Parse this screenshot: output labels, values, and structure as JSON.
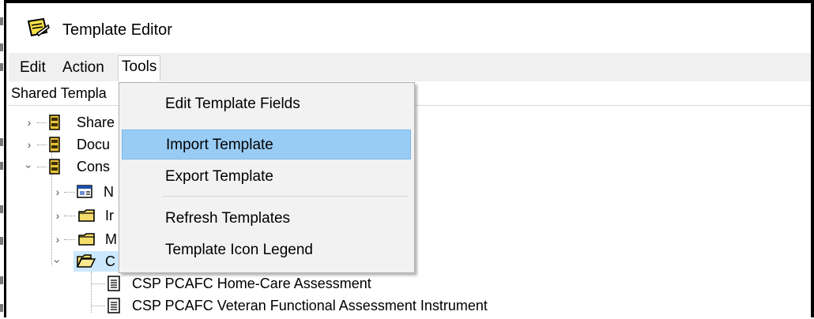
{
  "window": {
    "title": "Template Editor",
    "icon": "template-editor-icon"
  },
  "menubar": {
    "items": [
      {
        "label": "Edit",
        "mnemonic": "E"
      },
      {
        "label": "Action",
        "mnemonic": "A"
      },
      {
        "label": "Tools",
        "mnemonic": "T"
      }
    ]
  },
  "panel": {
    "header": "Shared Templa"
  },
  "tree": {
    "nodes": [
      {
        "label": "Share",
        "icon": "cabinet-icon",
        "expander": "collapsed"
      },
      {
        "label": "Docu",
        "icon": "cabinet-icon",
        "expander": "collapsed"
      },
      {
        "label": "Cons",
        "icon": "cabinet-icon",
        "expander": "expanded"
      },
      {
        "label": "N",
        "icon": "template-icon",
        "expander": "collapsed"
      },
      {
        "label": "Ir",
        "icon": "folder-icon",
        "expander": "collapsed"
      },
      {
        "label": "M",
        "icon": "folder-icon",
        "expander": "collapsed"
      },
      {
        "label": "C",
        "icon": "folder-open-icon",
        "expander": "expanded"
      },
      {
        "label": "CSP PCAFC Home-Care Assessment",
        "icon": "document-icon"
      },
      {
        "label": "CSP PCAFC Veteran Functional Assessment Instrument",
        "icon": "document-icon"
      }
    ]
  },
  "tools_menu": {
    "items": [
      {
        "label": "Edit Template Fields",
        "mnemonic": "F"
      },
      {
        "label": "Import Template",
        "mnemonic": "I",
        "highlighted": true
      },
      {
        "label": "Export Template",
        "mnemonic": "E"
      },
      {
        "label": "Refresh Templates",
        "mnemonic": "R"
      },
      {
        "label": "Template Icon Legend",
        "mnemonic": "T"
      }
    ]
  },
  "colors": {
    "highlight": "#99ccf5",
    "selected": "#cce8ff",
    "menubar": "#f0f0f0",
    "dropdown": "#f2f2f2"
  }
}
